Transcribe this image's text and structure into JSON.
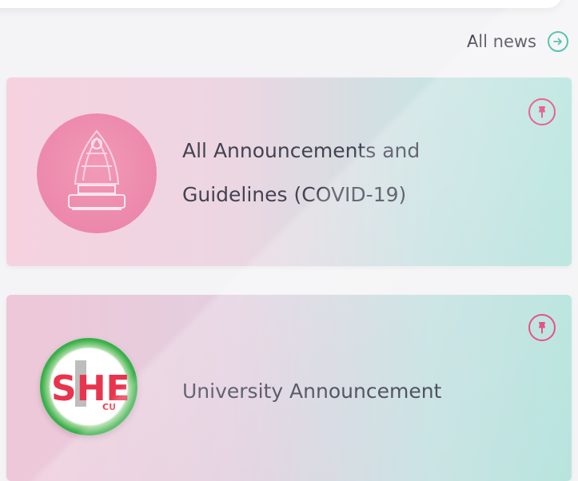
{
  "header": {
    "all_news_label": "All news",
    "all_news_icon": "arrow-right-circle-icon"
  },
  "announcements": [
    {
      "title": "All Announcements and Guidelines (COVID-19)",
      "logo": "chula-emblem-logo",
      "pin_icon": "pin-icon"
    },
    {
      "title": "University Announcement",
      "logo": "she-cu-logo",
      "she_text": "SHE",
      "cu_text": "CU",
      "pin_icon": "pin-icon"
    }
  ],
  "colors": {
    "accent_teal": "#34b8a0",
    "pin_pink": "#e6467e",
    "she_red": "#e8354d",
    "she_green": "#39b04a"
  }
}
